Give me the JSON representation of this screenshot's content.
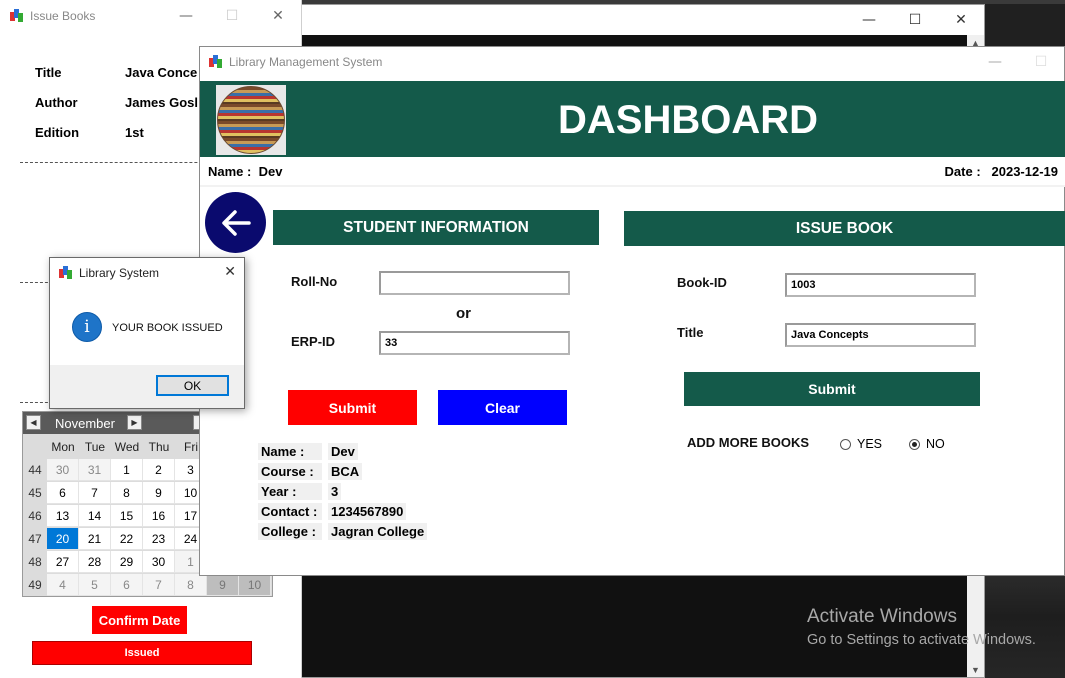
{
  "issue_window": {
    "title": "Issue Books",
    "rows": [
      {
        "label": "Title",
        "value": "Java Conce"
      },
      {
        "label": "Author",
        "value": "James Gosl"
      },
      {
        "label": "Edition",
        "value": "1st"
      }
    ],
    "calendar": {
      "month": "November",
      "day_headers": [
        "Mon",
        "Tue",
        "Wed",
        "Thu",
        "Fri"
      ],
      "weeks": [
        {
          "wk": "44",
          "days": [
            "30",
            "31",
            "1",
            "2",
            "3"
          ]
        },
        {
          "wk": "45",
          "days": [
            "6",
            "7",
            "8",
            "9",
            "10"
          ]
        },
        {
          "wk": "46",
          "days": [
            "13",
            "14",
            "15",
            "16",
            "17"
          ]
        },
        {
          "wk": "47",
          "days": [
            "20",
            "21",
            "22",
            "23",
            "24"
          ]
        },
        {
          "wk": "48",
          "days": [
            "27",
            "28",
            "29",
            "30",
            "1"
          ]
        },
        {
          "wk": "49",
          "days": [
            "4",
            "5",
            "6",
            "7",
            "8",
            "9",
            "10"
          ]
        }
      ],
      "selected": "20"
    },
    "confirm_date_label": "Confirm Date",
    "issued_label": "Issued"
  },
  "dialog": {
    "title": "Library System",
    "message": "YOUR BOOK ISSUED",
    "ok_label": "OK"
  },
  "dashboard": {
    "window_title": "Library Management System",
    "banner_title": "DASHBOARD",
    "name_label": "Name :",
    "name_value": "Dev",
    "date_label": "Date :",
    "date_value": "2023-12-19",
    "student_section": "STUDENT  INFORMATION",
    "roll_label": "Roll-No",
    "roll_value": "",
    "or_label": "or",
    "erp_label": "ERP-ID",
    "erp_value": "33",
    "submit_label": "Submit",
    "clear_label": "Clear",
    "student_info": [
      {
        "k": "Name :",
        "v": "Dev"
      },
      {
        "k": "Course :",
        "v": "BCA"
      },
      {
        "k": "Year :",
        "v": "3"
      },
      {
        "k": "Contact :",
        "v": "1234567890"
      },
      {
        "k": "College :",
        "v": "Jagran College"
      }
    ],
    "issue_section": "ISSUE BOOK",
    "book_id_label": "Book-ID",
    "book_id_value": "1003",
    "title_label": "Title",
    "title_value": "Java Concepts",
    "issue_submit_label": "Submit",
    "add_more_label": "ADD MORE BOOKS",
    "yes_label": "YES",
    "no_label": "NO",
    "add_more_selected": "NO"
  },
  "watermark": {
    "line1": "Activate Windows",
    "line2": "Go to Settings to activate Windows."
  },
  "colors": {
    "accent_green": "#145a4a",
    "red": "#ff0000",
    "blue": "#0000ff",
    "navy": "#0a0a6e",
    "selection": "#0078d7"
  }
}
